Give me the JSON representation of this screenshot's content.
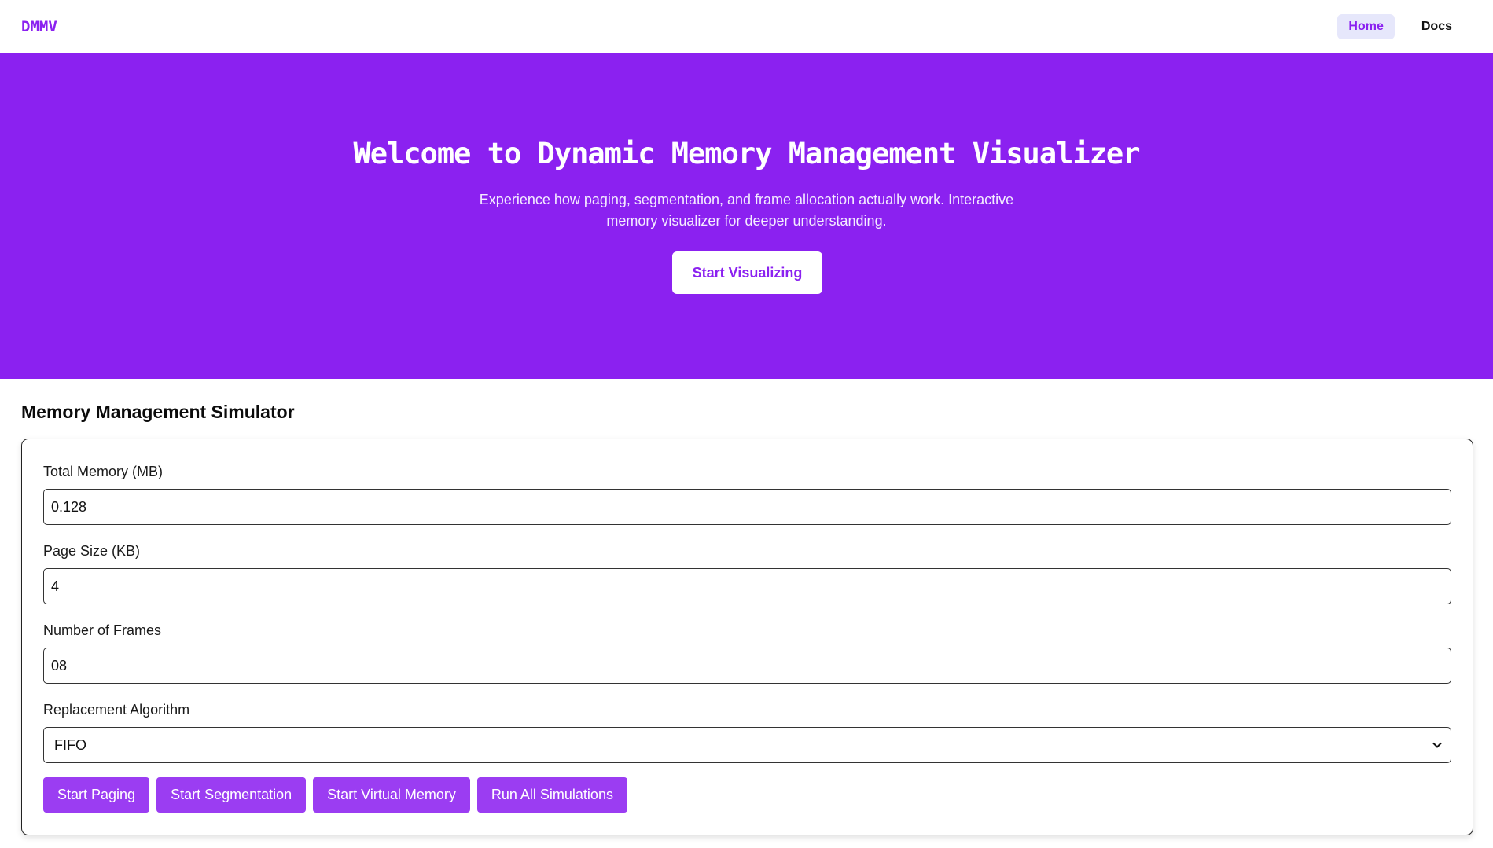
{
  "nav": {
    "logo": "DMMV",
    "links": [
      {
        "label": "Home",
        "active": true
      },
      {
        "label": "Docs",
        "active": false
      }
    ]
  },
  "hero": {
    "title": "Welcome to Dynamic Memory Management Visualizer",
    "subtitle": "Experience how paging, segmentation, and frame allocation actually work. Interactive memory visualizer for deeper understanding.",
    "cta_label": "Start Visualizing"
  },
  "simulator": {
    "title": "Memory Management Simulator",
    "fields": {
      "total_memory": {
        "label": "Total Memory (MB)",
        "value": "0.128"
      },
      "page_size": {
        "label": "Page Size (KB)",
        "value": "4"
      },
      "frames": {
        "label": "Number of Frames",
        "value": "08"
      },
      "algorithm": {
        "label": "Replacement Algorithm",
        "value": "FIFO"
      }
    },
    "buttons": {
      "paging": "Start Paging",
      "segmentation": "Start Segmentation",
      "virtual_memory": "Start Virtual Memory",
      "run_all": "Run All Simulations"
    }
  },
  "colors": {
    "brand": "#8b21f0",
    "button": "#9b3df2",
    "nav_active_bg": "#e6e7fb"
  },
  "icons": {
    "select_arrow": "chevron-down-icon"
  }
}
